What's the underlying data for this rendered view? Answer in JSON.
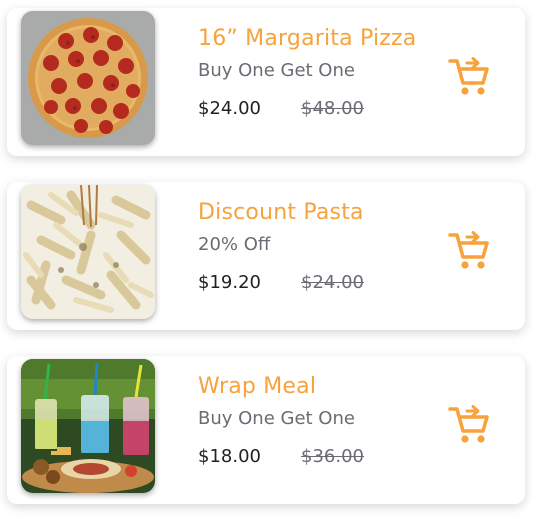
{
  "colors": {
    "accent": "#f7a23b",
    "price": "#222222",
    "muted": "#6b6b73"
  },
  "items": [
    {
      "title": "16” Margarita Pizza",
      "subtitle": "Buy One Get One",
      "price": "$24.00",
      "old_price": "$48.00",
      "image_icon": "pizza-image",
      "cart_icon": "add-to-cart-icon"
    },
    {
      "title": "Discount Pasta",
      "subtitle": "20% Off",
      "price": "$19.20",
      "old_price": "$24.00",
      "image_icon": "pasta-image",
      "cart_icon": "add-to-cart-icon"
    },
    {
      "title": "Wrap Meal",
      "subtitle": "Buy One Get One",
      "price": "$18.00",
      "old_price": "$36.00",
      "image_icon": "wrap-meal-image",
      "cart_icon": "add-to-cart-icon"
    }
  ]
}
